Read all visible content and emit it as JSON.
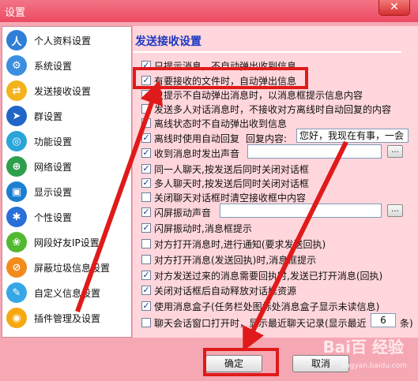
{
  "window": {
    "title": "设置",
    "close_glyph": "✕"
  },
  "sidebar": {
    "items": [
      {
        "label": "个人资料设置",
        "icon": "user-icon",
        "color": "#2f7fd6"
      },
      {
        "label": "系统设置",
        "icon": "system-icon",
        "color": "#3a8fe0"
      },
      {
        "label": "发送接收设置",
        "icon": "send-receive-icon",
        "color": "#f3b31d"
      },
      {
        "label": "群设置",
        "icon": "group-icon",
        "color": "#1f66c7"
      },
      {
        "label": "功能设置",
        "icon": "function-icon",
        "color": "#2aa5d8"
      },
      {
        "label": "网络设置",
        "icon": "network-icon",
        "color": "#2e9f4d"
      },
      {
        "label": "显示设置",
        "icon": "display-icon",
        "color": "#1a7fd1"
      },
      {
        "label": "个性设置",
        "icon": "personal-icon",
        "color": "#2b6fd8"
      },
      {
        "label": "网段好友IP设置",
        "icon": "ip-icon",
        "color": "#52b830"
      },
      {
        "label": "屏蔽垃圾信息设置",
        "icon": "block-icon",
        "color": "#f28a1c"
      },
      {
        "label": "自定义信息设置",
        "icon": "custom-info-icon",
        "color": "#36a7e6"
      },
      {
        "label": "插件管理及设置",
        "icon": "plugin-icon",
        "color": "#f5a80f"
      }
    ]
  },
  "panel": {
    "title": "发送接收设置",
    "options": [
      {
        "label": "只提示消息，不自动弹出收到信息",
        "checked": true
      },
      {
        "label": "有要接收的文件时，自动弹出信息",
        "checked": true
      },
      {
        "label": "只提示不自动弹出消息时，以消息框提示信息内容",
        "checked": false
      },
      {
        "label": "发送多人对话消息时，不接收对方离线时自动回复的内容",
        "checked": false
      },
      {
        "label": "离线状态时不自动弹出收到信息",
        "checked": false
      },
      {
        "label": "离线时使用自动回复",
        "checked": true
      },
      {
        "label": "收到消息时发出声音",
        "checked": true
      },
      {
        "label": "同一人聊天,按发送后同时关闭对话框",
        "checked": true
      },
      {
        "label": "多人聊天时,按发送后同时关闭对话框",
        "checked": true
      },
      {
        "label": "关闭聊天对话框时清空接收框中内容",
        "checked": false
      },
      {
        "label": "闪屏振动声音",
        "checked": true
      },
      {
        "label": "闪屏振动时,消息框提示",
        "checked": true
      },
      {
        "label": "对方打开消息时,进行通知(要求发送回执)",
        "checked": false
      },
      {
        "label": "对方打开消息(发送回执)时,消息框提示",
        "checked": false
      },
      {
        "label": "对方发送过来的消息需要回执时,发送已打开消息(回执)",
        "checked": true
      },
      {
        "label": "关闭对话框后自动释放对话框资源",
        "checked": true
      },
      {
        "label": "使用消息盒子(任务栏处图标处消息盒子显示未读信息)",
        "checked": true
      },
      {
        "label": "聊天会话窗口打开时，显示最近聊天记录(显示最近",
        "checked": false
      }
    ],
    "auto_reply_label": "回复内容:",
    "auto_reply_value": "您好，我现在有事，一会",
    "sound_path": "",
    "flash_sound_path": "",
    "browse_label": "...",
    "recent_count": "6",
    "recent_suffix": "条)"
  },
  "footer": {
    "ok_label": "确定",
    "cancel_label": "取消"
  },
  "watermark": {
    "text": "Bai百 经验",
    "sub": "jingyan.baidu.com"
  },
  "colors": {
    "accent_red": "#e01a1a",
    "title_blue": "#1a37c2",
    "window_pink": "#f5a8b4"
  }
}
